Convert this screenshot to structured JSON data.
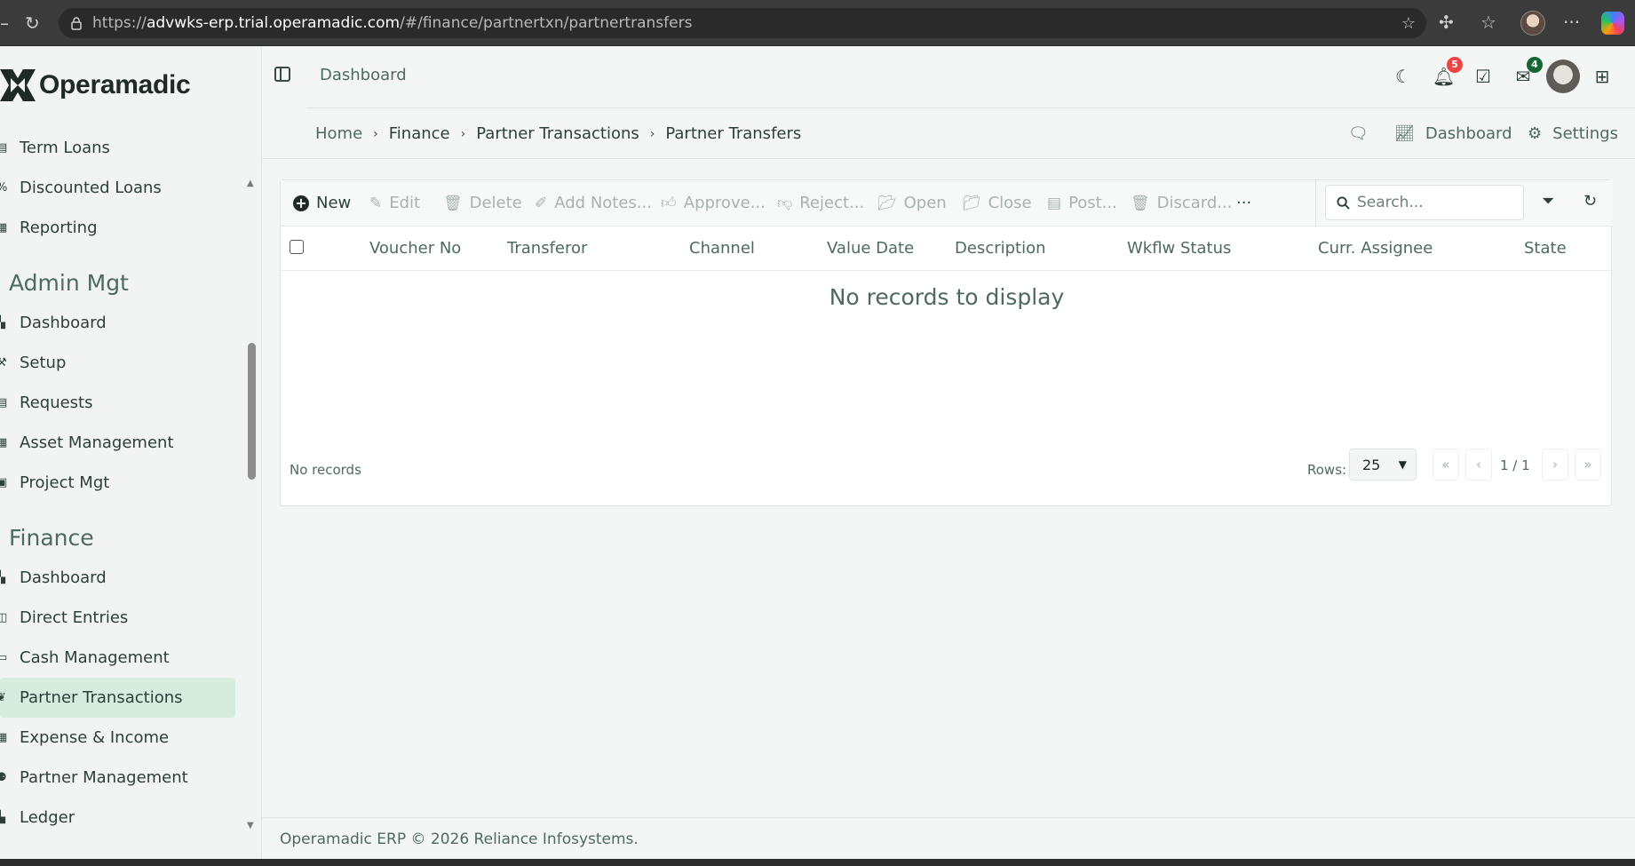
{
  "browser": {
    "url_prefix": "https://",
    "url_host": "advwks-erp.trial.operamadic.com",
    "url_path": "/#/finance/partnertxn/partnertransfers"
  },
  "app": {
    "logo_text": "Operamadic"
  },
  "sidebar": {
    "items_top": [
      {
        "label": "Term Loans",
        "icon": "loan-icon"
      },
      {
        "label": "Discounted Loans",
        "icon": "percent-icon"
      },
      {
        "label": "Reporting",
        "icon": "report-icon"
      }
    ],
    "admin": {
      "title": "Admin Mgt",
      "items": [
        {
          "label": "Dashboard",
          "icon": "dashboard-icon"
        },
        {
          "label": "Setup",
          "icon": "wrench-icon"
        },
        {
          "label": "Requests",
          "icon": "requests-icon"
        },
        {
          "label": "Asset Management",
          "icon": "asset-icon"
        },
        {
          "label": "Project Mgt",
          "icon": "clipboard-icon"
        }
      ]
    },
    "finance": {
      "title": "Finance",
      "items": [
        {
          "label": "Dashboard",
          "icon": "dashboard-icon"
        },
        {
          "label": "Direct Entries",
          "icon": "entries-icon"
        },
        {
          "label": "Cash Management",
          "icon": "cash-icon"
        },
        {
          "label": "Partner Transactions",
          "icon": "handshake-icon",
          "active": true
        },
        {
          "label": "Expense & Income",
          "icon": "calculator-icon"
        },
        {
          "label": "Partner Management",
          "icon": "people-icon"
        },
        {
          "label": "Ledger",
          "icon": "ledger-icon"
        }
      ]
    }
  },
  "topbar": {
    "title": "Dashboard",
    "notifications_count": "5",
    "messages_count": "4"
  },
  "breadcrumb": {
    "home": "Home",
    "finance": "Finance",
    "partner_transactions": "Partner Transactions",
    "current": "Partner Transfers"
  },
  "page_actions": {
    "dashboard": "Dashboard",
    "settings": "Settings"
  },
  "toolbar": {
    "new": "New",
    "edit": "Edit",
    "delete": "Delete",
    "add_notes": "Add Notes...",
    "approve": "Approve...",
    "reject": "Reject...",
    "open": "Open",
    "close": "Close",
    "post": "Post...",
    "discard": "Discard...",
    "more": "···",
    "search_placeholder": "Search..."
  },
  "table": {
    "columns": [
      "Voucher No",
      "Transferor",
      "Channel",
      "Value Date",
      "Description",
      "Wkflw Status",
      "Curr. Assignee",
      "State"
    ],
    "empty_message": "No records to display"
  },
  "pagination": {
    "records_text": "No records",
    "rows_label": "Rows:",
    "rows_value": "25",
    "first": "«",
    "prev": "‹",
    "page_info": "1 / 1",
    "next": "›",
    "last": "»"
  },
  "footer": {
    "text": "Operamadic ERP © 2026 Reliance Infosystems."
  },
  "colors": {
    "accent_active": "#d6ecdf",
    "text_muted": "#4e6a5f",
    "badge_red": "#ef4444",
    "badge_green": "#166534"
  }
}
